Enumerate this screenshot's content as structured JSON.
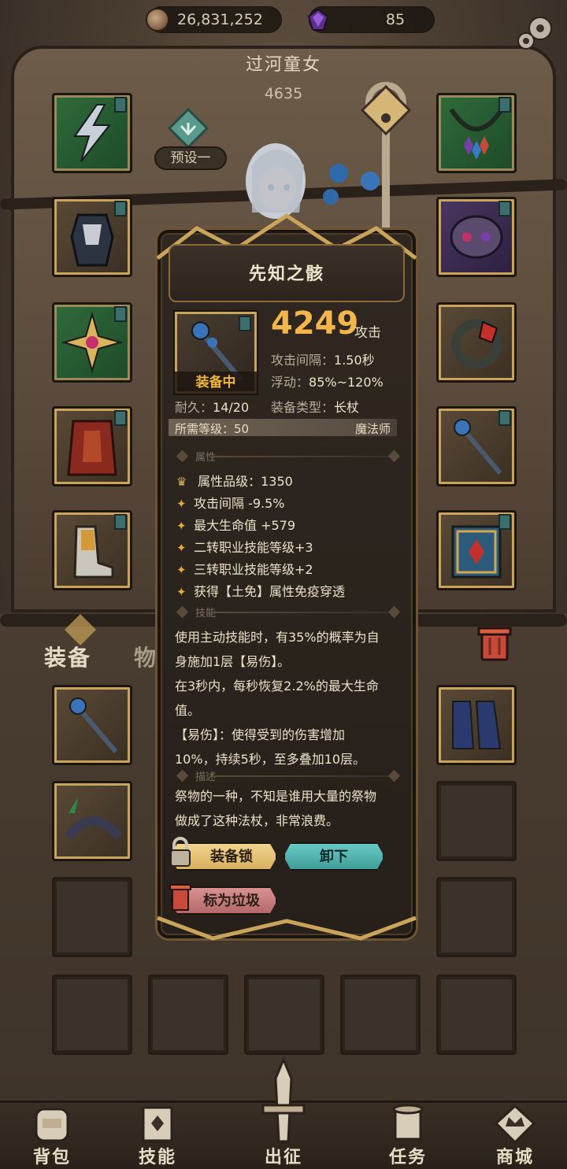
{
  "resources": {
    "gold": "26,831,252",
    "gems": "85"
  },
  "character": {
    "name": "过河童女",
    "power": "4635",
    "preset": "预设一"
  },
  "tabs": {
    "equipment": "装备",
    "items": "物品"
  },
  "item_popup": {
    "name": "先知之骸",
    "attack": "4249",
    "attack_suffix": "攻击",
    "equipped_tag": "装备中",
    "attack_interval_label": "攻击间隔：",
    "attack_interval_value": "1.50秒",
    "float_label": "浮动：",
    "float_value": "85%~120%",
    "durability_label": "耐久：",
    "durability_value": "14/20",
    "type_label": "装备类型：",
    "type_value": "长杖",
    "required_level": "所需等级：50",
    "required_class": "魔法师",
    "section_attributes": "属性",
    "attribute_grade": "属性品级：1350",
    "attributes": [
      "攻击间隔 -9.5%",
      "最大生命值 +579",
      "二转职业技能等级+3",
      "三转职业技能等级+2",
      "获得【土免】属性免疫穿透"
    ],
    "section_skill": "技能",
    "skill_lines": [
      "使用主动技能时，有35%的概率为自",
      "身施加1层【易伤】。",
      "在3秒内，每秒恢复2.2%的最大生命",
      "值。",
      "【易伤】：使得受到的伤害增加",
      "10%，持续5秒，至多叠加10层。"
    ],
    "section_description": "描述",
    "description_lines": [
      "祭物的一种，不知是谁用大量的祭物",
      "做成了这种法杖，非常浪费。"
    ],
    "buttons": {
      "lock": "装备锁",
      "unequip": "卸下",
      "mark_trash": "标为垃圾"
    }
  },
  "bottom_nav": [
    {
      "label": "背包",
      "icon": "backpack-icon"
    },
    {
      "label": "技能",
      "icon": "skill-book-icon"
    },
    {
      "label": "出征",
      "icon": "sword-icon"
    },
    {
      "label": "任务",
      "icon": "scroll-icon"
    },
    {
      "label": "商城",
      "icon": "shop-crown-icon"
    }
  ],
  "colors": {
    "accent_gold": "#f4b64a",
    "equipped_orange": "#f1b43c",
    "unequip_teal": "#3f9e9a",
    "trash_red": "#b46a6a",
    "lock_yellow": "#d8b160"
  }
}
